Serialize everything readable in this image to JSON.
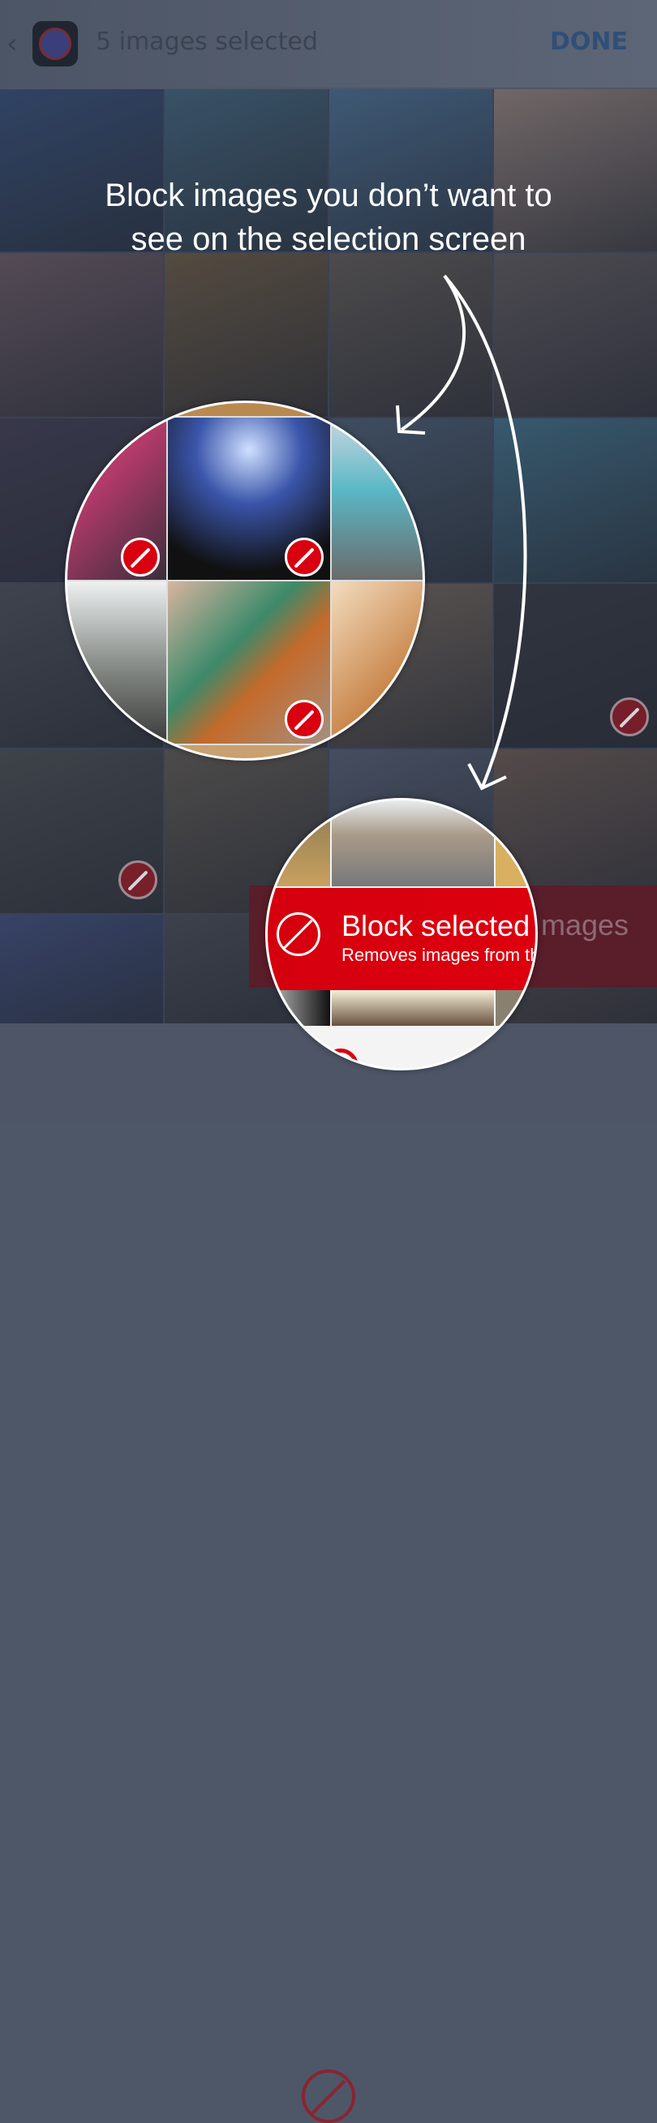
{
  "header": {
    "back_icon": "chevron-left-icon",
    "app_icon": "block-app-icon",
    "title": "5 images selected",
    "done_label": "DONE",
    "done_color": "#2f4f78"
  },
  "caption": {
    "line1": "Block images you don’t want to",
    "line2": "see on the selection screen"
  },
  "banner": {
    "title": "Block selected images",
    "subtitle": "Removes images from this app",
    "icon": "block-icon",
    "color": "#d9000f"
  },
  "grid": {
    "photos": [
      "dusk lake",
      "forest lake",
      "harbor town",
      "ice cream cone",
      "balloons",
      "food plate",
      "cookies",
      "dog in snow",
      "striped scarf",
      "concert crowd",
      "man sitting",
      "seaside houses",
      "motorcycle",
      "tattoo arm",
      "girl on swing",
      "cheering crowd",
      "stone wall",
      "terrier dog",
      "street scene",
      "pit bull",
      "graffiti",
      "graffiti what",
      "sunglasses",
      "cafe"
    ]
  },
  "bottombar": {
    "icon": "block-icon"
  }
}
